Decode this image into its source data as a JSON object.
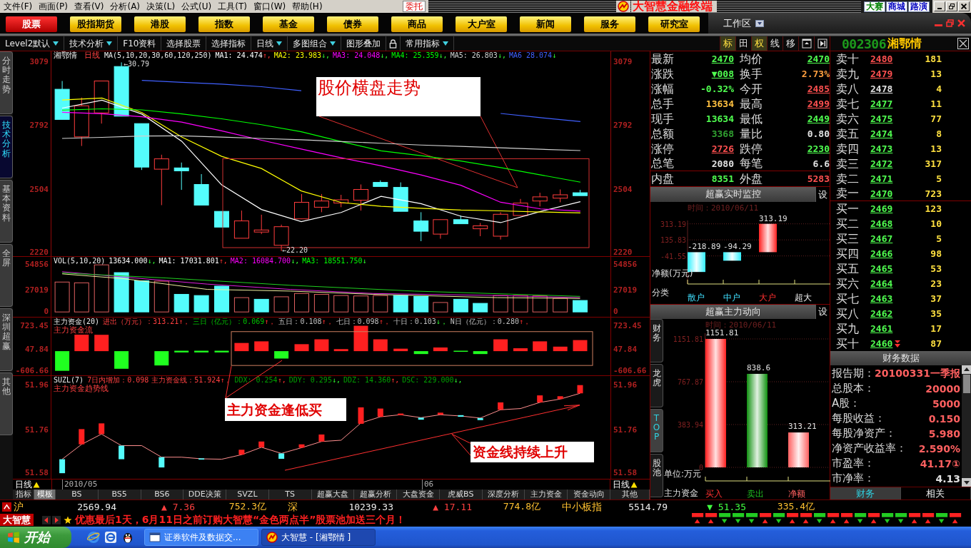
{
  "menu_bar": {
    "items": [
      "文件(F)",
      "画面(P)",
      "查看(V)",
      "分析(A)",
      "决策(L)",
      "公式(U)",
      "工具(T)",
      "窗口(W)",
      "帮助(H)"
    ],
    "order_button": "委托",
    "app_title": "大智慧金融终端",
    "links": [
      {
        "label": "大赛",
        "color": "#008000"
      },
      {
        "label": "商城",
        "color": "#0000c0"
      },
      {
        "label": "路演",
        "color": "#0000c0"
      }
    ]
  },
  "nav_tabs": [
    {
      "label": "股票",
      "selected": true
    },
    {
      "label": "股指期货",
      "selected": false
    },
    {
      "label": "港股",
      "selected": false
    },
    {
      "label": "指数",
      "selected": false
    },
    {
      "label": "基金",
      "selected": false
    },
    {
      "label": "债券",
      "selected": false
    },
    {
      "label": "商品",
      "selected": false
    },
    {
      "label": "大户室",
      "selected": false
    },
    {
      "label": "新闻",
      "selected": false
    },
    {
      "label": "服务",
      "selected": false
    },
    {
      "label": "研究室",
      "selected": false
    }
  ],
  "workspace": "工作区",
  "toolbar": [
    {
      "kind": "button",
      "label": "Level2默认",
      "dropdown": true
    },
    {
      "kind": "button",
      "label": "技术分析",
      "dropdown": true
    },
    {
      "kind": "button",
      "label": "F10资料",
      "dropdown": false
    },
    {
      "kind": "button",
      "label": "选择股票",
      "dropdown": false
    },
    {
      "kind": "button",
      "label": "选择指标",
      "dropdown": false
    },
    {
      "kind": "button",
      "label": "日线",
      "dropdown": true
    },
    {
      "kind": "button",
      "label": "多图组合",
      "dropdown": true
    },
    {
      "kind": "button",
      "label": "图形叠加",
      "dropdown": false
    },
    {
      "kind": "lock"
    },
    {
      "kind": "button",
      "label": "常用指标",
      "dropdown": true
    }
  ],
  "view_buttons": [
    {
      "label": "标",
      "selected": true
    },
    {
      "label": "田",
      "selected": false
    },
    {
      "label": "权",
      "selected": true
    },
    {
      "label": "线",
      "selected": false
    },
    {
      "label": "移",
      "selected": false
    }
  ],
  "stock": {
    "code": "002306",
    "name": "湘鄂情"
  },
  "side_tabs": [
    {
      "label": "分时走势",
      "selected": false
    },
    {
      "label": "技术分析",
      "selected": true
    },
    {
      "label": "基本资料",
      "selected": false
    },
    {
      "label": "全屏",
      "selected": false
    },
    {
      "label": "深圳超赢",
      "selected": false
    },
    {
      "label": "其他",
      "selected": false
    }
  ],
  "price_panel": {
    "name": "湘鄂情",
    "period": "日线",
    "params": "MA(5,10,20,30,60,120,250)",
    "indicators": [
      {
        "value": ": 24.474",
        "arrow": "↑,",
        "rising": true
      },
      {
        "value": ": 23.983",
        "arrow": "↓,",
        "rising": false
      },
      {
        "value": ": 24.048",
        "arrow": "↓,",
        "rising": false
      },
      {
        "value": ": 25.359",
        "arrow": "↓,",
        "rising": false
      },
      {
        "value": ": 26.803",
        "arrow": "↓,",
        "rising": false
      },
      {
        "value": " 28.074",
        "arrow": "↓",
        "rising": false
      }
    ],
    "chart_data": {
      "type": "line",
      "ylim": [
        2201,
        3128
      ],
      "yticks": [
        3079,
        2792,
        2504,
        2220
      ],
      "series": [
        {
          "name": "MA1",
          "color": "#ffffff",
          "values": [
            2871,
            2907,
            2844,
            2721,
            2524,
            2412,
            2357,
            2399,
            2472,
            2439,
            2382,
            2353,
            2403,
            2448
          ]
        },
        {
          "name": "MA2",
          "color": "#ffff00",
          "values": [
            2908,
            2917,
            2851,
            2740,
            2653,
            2598,
            2496,
            2444,
            2427,
            2418,
            2410,
            2406,
            2401,
            2397
          ]
        },
        {
          "name": "MA3",
          "color": "#ff00ff",
          "values": [
            2852,
            2846,
            2832,
            2808,
            2768,
            2726,
            2686,
            2646,
            2610,
            2569,
            2522,
            2445,
            2415,
            2405
          ]
        },
        {
          "name": "MA4",
          "color": "#00ff00",
          "values": [
            2862,
            2868,
            2863,
            2845,
            2823,
            2796,
            2764,
            2720,
            2678,
            2656,
            2632,
            2602,
            2569,
            2536
          ]
        },
        {
          "name": "MA5",
          "color": "#d0d0d0",
          "values": [
            2734,
            2739,
            2745,
            2746,
            2740,
            2734,
            2728,
            2720,
            2712,
            2704,
            2698,
            2692,
            2685,
            2679
          ]
        },
        {
          "name": "MA6",
          "color": "#4060ff",
          "values": [
            null,
            null,
            2997,
            2988,
            2980,
            2968,
            2950,
            null,
            null,
            null,
            null,
            2847,
            2828,
            2810
          ]
        }
      ]
    },
    "right_axis": [
      "3079",
      "2792",
      "2504",
      "2220"
    ],
    "high_label": "←30.79",
    "low_label": "←22.20",
    "note": "股价横盘走势"
  },
  "volume_panel": {
    "params": "VOL(5,10,20)",
    "indicators": [
      {
        "text": "13634.000",
        "arrow": "↓,",
        "rising": false,
        "color": "#ffffff"
      },
      {
        "text": "MA1: 17031.801",
        "arrow": "↑,",
        "rising": true,
        "color": "#ffffff"
      },
      {
        "text": "MA2: 16084.700",
        "arrow": "↓,",
        "rising": false,
        "color": "#ff00ff"
      },
      {
        "text": "MA3: 18551.750",
        "arrow": "↓",
        "rising": false,
        "color": "#00ff00"
      }
    ],
    "left_axis": [
      "54856",
      "27019",
      "0"
    ],
    "right_axis": [
      "54856",
      "27019",
      "0"
    ]
  },
  "money_panel": {
    "params": "主力资金(20)",
    "indicators": [
      {
        "text": "进出（万元）：313.21",
        "arrow": "↑，",
        "rising": true,
        "color": "#ff4040"
      },
      {
        "text": "三日（亿元）：0.069",
        "arrow": "↑，",
        "rising": true,
        "color": "#00c000"
      },
      {
        "text": "五日：0.108",
        "arrow": "↑，",
        "rising": true,
        "color": "#c0c0c0"
      },
      {
        "text": "七日：0.098",
        "arrow": "↑，",
        "rising": true,
        "color": "#c0c0c0"
      },
      {
        "text": "十日：0.103",
        "arrow": "↓，",
        "rising": false,
        "color": "#c0c0c0"
      },
      {
        "text": "N日（亿元）：0.280",
        "arrow": "↑，",
        "rising": true,
        "color": "#c0c0c0"
      }
    ],
    "subtitle": "主力资金流",
    "left_axis": [
      "723.45",
      "47.84",
      "-606.66"
    ],
    "right_axis": [
      "723.45",
      "47.84",
      "-606.66"
    ]
  },
  "trend_panel": {
    "params": "SUZL(7)",
    "indicators": [
      {
        "text": "7日内增加：0.098",
        "color": "#ff4040"
      },
      {
        "text": "主力资金线：51.924",
        "arrow": "↑，",
        "rising": true,
        "color": "#ff4040"
      },
      {
        "text": "DDX: 0.254",
        "arrow": "↑,",
        "rising": true,
        "color": "#00a000"
      },
      {
        "text": "DDY: 0.295",
        "arrow": "↓,",
        "rising": false,
        "color": "#00a000"
      },
      {
        "text": "DDZ: 14.360",
        "arrow": "↑,",
        "rising": true,
        "color": "#00a000"
      },
      {
        "text": "DSC: 229.000",
        "arrow": "↓,",
        "rising": false,
        "color": "#00a000"
      }
    ],
    "subtitle": "主力资金趋势线",
    "left_axis": [
      "51.96",
      "51.76",
      "51.58"
    ],
    "right_axis": [
      "51.96",
      "51.76",
      "51.58"
    ],
    "notes": [
      "主力资金逢低买",
      "资金线持续上升"
    ]
  },
  "x_axis": {
    "period_left": "日线",
    "labels": [
      "2010/05",
      "06"
    ],
    "period_right": "日线"
  },
  "indicator_tabs": [
    {
      "label": "指标",
      "selected": false
    },
    {
      "label": "模板",
      "selected": true
    },
    {
      "label": "BS",
      "selected": false
    },
    {
      "label": "BS5",
      "selected": false
    },
    {
      "label": "BS6",
      "selected": false
    },
    {
      "label": "DDE决策",
      "selected": false
    },
    {
      "label": "SVZL",
      "selected": false
    },
    {
      "label": "TS",
      "selected": false
    },
    {
      "label": "超赢大盘",
      "selected": false
    },
    {
      "label": "超赢分析",
      "selected": false
    },
    {
      "label": "大盘资金",
      "selected": false
    },
    {
      "label": "虎威BS",
      "selected": false
    },
    {
      "label": "深度分析",
      "selected": false
    },
    {
      "label": "主力资金",
      "selected": false
    },
    {
      "label": "资金动向",
      "selected": false
    },
    {
      "label": "其他",
      "selected": false
    }
  ],
  "quote_rows": [
    [
      {
        "label": "最新",
        "value": "2470",
        "color": "#50ff50",
        "underlined": true
      },
      {
        "label": "均价",
        "value": "2470",
        "color": "#50ff50",
        "underlined": true
      }
    ],
    [
      {
        "label": "涨跌",
        "value": "▼008",
        "color": "#50ff50",
        "underlined": true
      },
      {
        "label": "换手",
        "value": "2.73%",
        "color": "#ffa040",
        "underlined": false
      }
    ],
    [
      {
        "label": "涨幅",
        "value": "-0.32%",
        "color": "#50ff50",
        "underlined": false
      },
      {
        "label": "今开",
        "value": "2485",
        "color": "#ff5050",
        "underlined": true
      }
    ],
    [
      {
        "label": "总手",
        "value": "13634",
        "color": "#ffc040",
        "underlined": false
      },
      {
        "label": "最高",
        "value": "2499",
        "color": "#ff5050",
        "underlined": true
      }
    ],
    [
      {
        "label": "现手",
        "value": "13634",
        "color": "#50ff50",
        "underlined": false
      },
      {
        "label": "最低",
        "value": "2449",
        "color": "#50ff50",
        "underlined": true
      }
    ],
    [
      {
        "label": "总额",
        "value": "3368",
        "color": "#30a030",
        "underlined": false
      },
      {
        "label": "量比",
        "value": "0.80",
        "color": "#e0e0e0",
        "underlined": false
      }
    ],
    [
      {
        "label": "涨停",
        "value": "2726",
        "color": "#ff5050",
        "underlined": true
      },
      {
        "label": "跌停",
        "value": "2230",
        "color": "#50ff50",
        "underlined": true
      }
    ],
    [
      {
        "label": "总笔",
        "value": "2080",
        "color": "#e0e0e0",
        "underlined": false
      },
      {
        "label": "每笔",
        "value": "6.6",
        "color": "#e0e0e0",
        "underlined": false
      }
    ],
    [
      {
        "label": "内盘",
        "value": "8351",
        "color": "#50ff50",
        "underlined": false
      },
      {
        "label": "外盘",
        "value": "5283",
        "color": "#ff5050",
        "underlined": false
      }
    ]
  ],
  "realtime_monitor": {
    "title": "超赢实时监控",
    "settings": "设",
    "time": "时间：2010/06/11",
    "chart_data": {
      "type": "bar",
      "xlabel": "分类",
      "ylabel": "净额(万元)",
      "categories": [
        "散户",
        "中户",
        "大户",
        "超大"
      ],
      "values": [
        -218.89,
        -94.29,
        313.19,
        null
      ],
      "ylim": [
        -351.7,
        350.2
      ],
      "yticks": [
        313.19,
        135.83,
        -41.55
      ],
      "grid": true,
      "data_labels": true
    }
  },
  "main_force": {
    "title": "超赢主力动向",
    "settings": "设",
    "tabs": [
      {
        "label": "财务",
        "selected": false
      },
      {
        "label": "龙虎",
        "selected": false
      },
      {
        "label": "TOP",
        "selected": true
      },
      {
        "label": "股池",
        "selected": false
      }
    ],
    "time": "时间：2010/06/11",
    "chart_data": {
      "type": "bar",
      "xlabel": "主力资金",
      "ylabel": "单位:万元",
      "categories": [
        "买入",
        "卖出",
        "净额"
      ],
      "values": [
        1151.81,
        838.6,
        313.21
      ],
      "ylim": [
        0,
        1203
      ],
      "yticks": [
        0,
        383.94,
        767.87,
        1151.81
      ],
      "grid": true,
      "data_labels": true
    }
  },
  "order_book": {
    "asks": [
      {
        "label": "卖十",
        "price": "2480",
        "volume": "181",
        "color": "#ff5050"
      },
      {
        "label": "卖九",
        "price": "2479",
        "volume": "13",
        "color": "#ff5050"
      },
      {
        "label": "卖八",
        "price": "2478",
        "volume": "4",
        "color": "#e0e0e0"
      },
      {
        "label": "卖七",
        "price": "2477",
        "volume": "11",
        "color": "#50ff50"
      },
      {
        "label": "卖六",
        "price": "2475",
        "volume": "77",
        "color": "#50ff50"
      },
      {
        "label": "卖五",
        "price": "2474",
        "volume": "8",
        "color": "#50ff50"
      },
      {
        "label": "卖四",
        "price": "2473",
        "volume": "13",
        "color": "#50ff50"
      },
      {
        "label": "卖三",
        "price": "2472",
        "volume": "317",
        "color": "#50ff50"
      },
      {
        "label": "卖二",
        "price": "2471",
        "volume": "5",
        "color": "#50ff50"
      },
      {
        "label": "卖一",
        "price": "2470",
        "volume": "723",
        "color": "#50ff50"
      }
    ],
    "bids": [
      {
        "label": "买一",
        "price": "2469",
        "volume": "123",
        "color": "#50ff50",
        "more_below": false
      },
      {
        "label": "买二",
        "price": "2468",
        "volume": "10",
        "color": "#50ff50",
        "more_below": false
      },
      {
        "label": "买三",
        "price": "2467",
        "volume": "5",
        "color": "#50ff50",
        "more_below": false
      },
      {
        "label": "买四",
        "price": "2466",
        "volume": "98",
        "color": "#50ff50",
        "more_below": false
      },
      {
        "label": "买五",
        "price": "2465",
        "volume": "53",
        "color": "#50ff50",
        "more_below": false
      },
      {
        "label": "买六",
        "price": "2464",
        "volume": "23",
        "color": "#50ff50",
        "more_below": false
      },
      {
        "label": "买七",
        "price": "2463",
        "volume": "37",
        "color": "#50ff50",
        "more_below": false
      },
      {
        "label": "买八",
        "price": "2462",
        "volume": "35",
        "color": "#50ff50",
        "more_below": false
      },
      {
        "label": "买九",
        "price": "2461",
        "volume": "17",
        "color": "#50ff50",
        "more_below": false
      },
      {
        "label": "买十",
        "price": "2460",
        "volume": "87",
        "color": "#50ff50",
        "more_below": true
      }
    ]
  },
  "finance": {
    "title": "财务数据",
    "rows": [
      {
        "label": "报告期：",
        "value": "20100331一季报",
        "color": "#ff6060"
      },
      {
        "label": "总股本：",
        "value": "20000",
        "color": "#ff6060"
      },
      {
        "label": "A股：",
        "value": "5000",
        "color": "#ff6060"
      },
      {
        "label": "每股收益：",
        "value": "0.150",
        "color": "#ff6060"
      },
      {
        "label": "每股净资产：",
        "value": "5.980",
        "color": "#ff6060"
      },
      {
        "label": "净资产收益率：",
        "value": "2.590%",
        "color": "#ff6060"
      },
      {
        "label": "市盈率：",
        "value": "41.17①",
        "color": "#ff6060"
      },
      {
        "label": "市净率：",
        "value": "4.13",
        "color": "#e0e0e0"
      }
    ],
    "tabs": [
      {
        "label": "财务",
        "selected": true
      },
      {
        "label": "相关",
        "selected": false
      }
    ]
  },
  "market_bar": [
    {
      "name": "沪",
      "value": "2569.94",
      "change": "▲ 7.36",
      "rising": true,
      "turnover": "752.3亿"
    },
    {
      "name": "深",
      "value": "10239.33",
      "change": "▲ 17.11",
      "rising": true,
      "turnover": "774.8亿"
    },
    {
      "name": "中小板指",
      "value": "5514.79",
      "change": "▼ 51.35",
      "rising": false,
      "turnover": "335.4亿"
    }
  ],
  "ticker": {
    "brand": "大智慧",
    "message": "优惠最后1天，6月11日之前订购大智慧“金色两点半”股票池加送三个月！"
  },
  "taskbar": {
    "start": "开始",
    "tasks": [
      {
        "label": "证券软件及数据交...",
        "selected": false
      },
      {
        "label": "大智慧 - [湘鄂情 ]",
        "selected": true
      }
    ]
  }
}
